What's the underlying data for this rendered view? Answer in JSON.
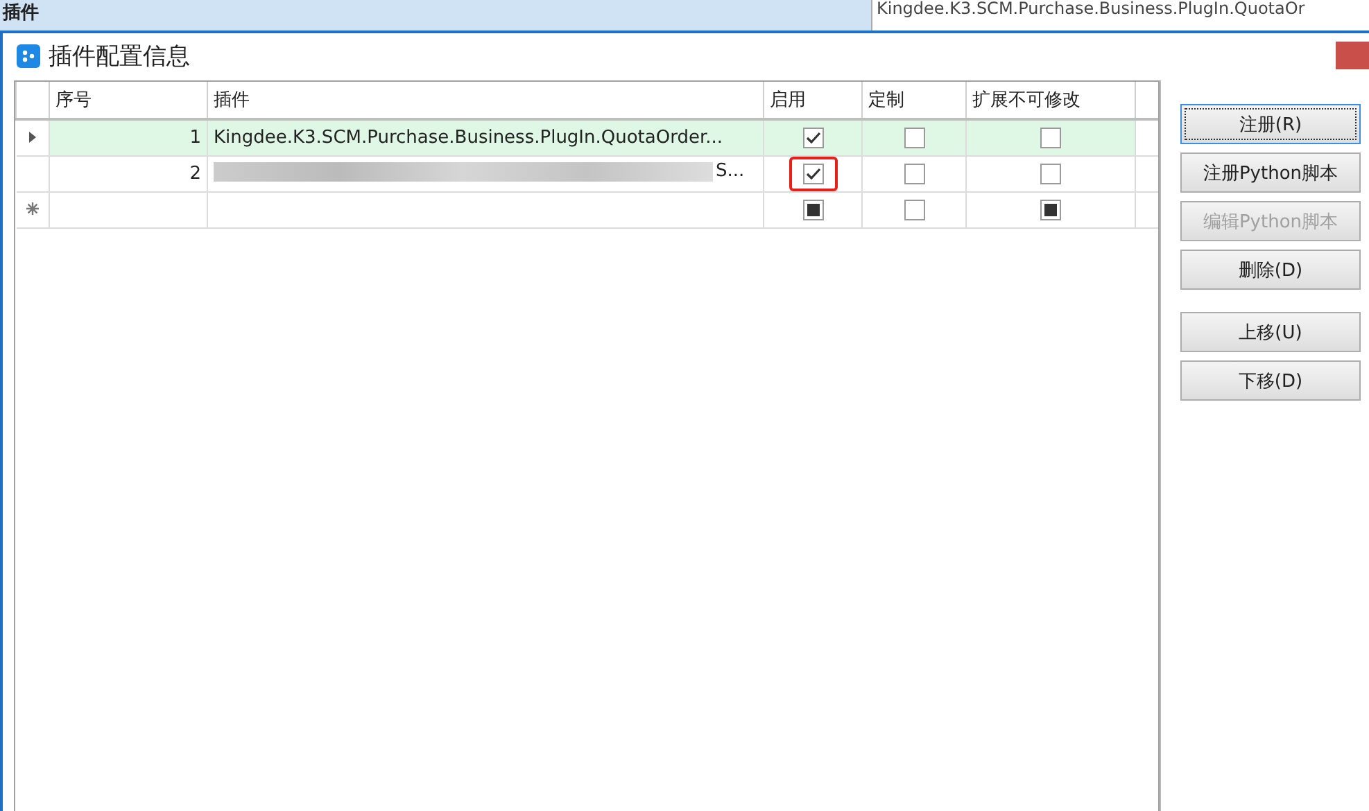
{
  "background": {
    "label": "插件",
    "value": "Kingdee.K3.SCM.Purchase.Business.PlugIn.QuotaOr"
  },
  "window": {
    "title": "插件配置信息"
  },
  "table": {
    "columns": [
      "序号",
      "插件",
      "启用",
      "定制",
      "扩展不可修改"
    ],
    "rows": [
      {
        "selected": true,
        "kind": "data",
        "seq": "1",
        "plugin": "Kingdee.K3.SCM.Purchase.Business.PlugIn.QuotaOrder...",
        "redacted": false,
        "checks": [
          {
            "checked": true,
            "highlighted": false
          },
          {
            "checked": false,
            "highlighted": false
          },
          {
            "checked": false,
            "highlighted": false
          }
        ]
      },
      {
        "selected": false,
        "kind": "data",
        "seq": "2",
        "plugin": "S...",
        "redacted": true,
        "checks": [
          {
            "checked": true,
            "highlighted": true
          },
          {
            "checked": false,
            "highlighted": false
          },
          {
            "checked": false,
            "highlighted": false
          }
        ]
      },
      {
        "selected": false,
        "kind": "new",
        "checks": [
          {
            "checked": true,
            "highlighted": false
          },
          {
            "checked": false,
            "highlighted": false
          },
          {
            "checked": true,
            "highlighted": false
          }
        ]
      }
    ]
  },
  "button_groups": [
    [
      {
        "label": "注册(R)",
        "focused": true,
        "disabled": false
      },
      {
        "label": "注册Python脚本",
        "focused": false,
        "disabled": false
      },
      {
        "label": "编辑Python脚本",
        "focused": false,
        "disabled": true
      },
      {
        "label": "删除(D)",
        "focused": false,
        "disabled": false
      }
    ],
    [
      {
        "label": "上移(U)",
        "focused": false,
        "disabled": false
      },
      {
        "label": "下移(D)",
        "focused": false,
        "disabled": false
      }
    ]
  ]
}
